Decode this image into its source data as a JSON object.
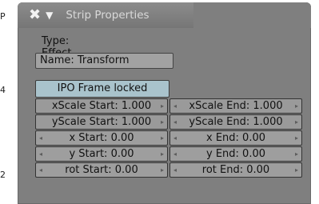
{
  "side_markers": [
    "P",
    "4",
    "2"
  ],
  "panel": {
    "title": "Strip Properties",
    "icons": [
      "close-icon",
      "collapse-arrow-icon"
    ]
  },
  "strip": {
    "type_label": "Type: Effect",
    "name_value": "Name: Transform",
    "ipo_button": "IPO Frame locked"
  },
  "fields": [
    {
      "left": "xScale Start: 1.000",
      "right": "xScale End: 1.000"
    },
    {
      "left": "yScale Start: 1.000",
      "right": "yScale End: 1.000"
    },
    {
      "left": "x Start: 0.00",
      "right": "x End: 0.00"
    },
    {
      "left": "y Start: 0.00",
      "right": "y End: 0.00"
    },
    {
      "left": "rot Start: 0.00",
      "right": "rot End: 0.00"
    }
  ],
  "colors": {
    "panel_bg": "#7f7f7f",
    "ipo_button": "#a9c3cc",
    "field_bg": "#9a9a9a"
  }
}
